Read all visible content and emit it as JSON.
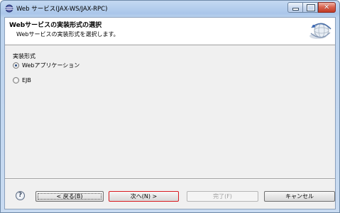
{
  "window": {
    "title": "Web サービス(JAX-WS/JAX-RPC)"
  },
  "header": {
    "title": "Webサービスの実装形式の選択",
    "description": "Webサービスの実装形式を選択します。"
  },
  "form": {
    "group_label": "実装形式",
    "options": [
      {
        "label": "Webアプリケーション",
        "selected": true
      },
      {
        "label": "EJB",
        "selected": false
      }
    ]
  },
  "buttons": {
    "help": "?",
    "back": "< 戻る(B)",
    "next": "次へ(N) >",
    "finish": "完了(F)",
    "cancel": "キャンセル"
  },
  "colors": {
    "title_bar": "#bcd3ee",
    "dialog_background": "#f0f0f0",
    "header_background": "#ffffff",
    "next_button_highlight": "#d81b20",
    "disabled_text": "#a0a0a0"
  }
}
